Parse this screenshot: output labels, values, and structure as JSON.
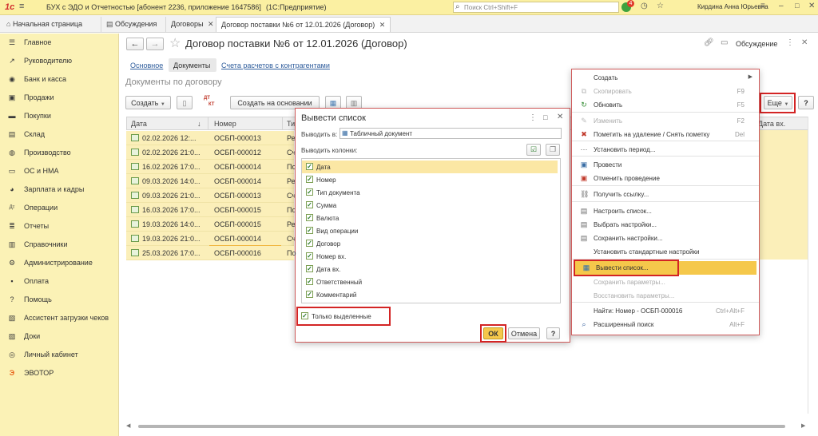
{
  "titlebar": {
    "app_title": "БУХ с ЭДО и Отчетностью [абонент 2236, приложение 1647586]",
    "platform": "(1С:Предприятие)",
    "search_placeholder": "Поиск Ctrl+Shift+F",
    "notification_count": "4",
    "user": "Кирдина Анна Юрьевна"
  },
  "tabs": [
    {
      "label": "Начальная страница"
    },
    {
      "label": "Обсуждения"
    },
    {
      "label": "Договоры"
    },
    {
      "label": "Договор поставки №6 от 12.01.2026 (Договор)"
    }
  ],
  "sidebar": {
    "items": [
      {
        "label": "Главное",
        "icon": "menu-icon"
      },
      {
        "label": "Руководителю",
        "icon": "chart-icon"
      },
      {
        "label": "Банк и касса",
        "icon": "bank-icon"
      },
      {
        "label": "Продажи",
        "icon": "bag-icon"
      },
      {
        "label": "Покупки",
        "icon": "cart-icon"
      },
      {
        "label": "Склад",
        "icon": "warehouse-icon"
      },
      {
        "label": "Производство",
        "icon": "factory-icon"
      },
      {
        "label": "ОС и НМА",
        "icon": "truck-icon"
      },
      {
        "label": "Зарплата и кадры",
        "icon": "people-icon"
      },
      {
        "label": "Операции",
        "icon": "operations-icon"
      },
      {
        "label": "Отчеты",
        "icon": "reports-icon"
      },
      {
        "label": "Справочники",
        "icon": "books-icon"
      },
      {
        "label": "Администрирование",
        "icon": "gear-icon"
      },
      {
        "label": "Оплата",
        "icon": "payment-icon"
      },
      {
        "label": "Помощь",
        "icon": "help-icon"
      },
      {
        "label": "Ассистент загрузки чеков",
        "icon": "receipt-icon"
      },
      {
        "label": "Доки",
        "icon": "docs-icon"
      },
      {
        "label": "Личный кабинет",
        "icon": "user-icon"
      },
      {
        "label": "ЭВОТОР",
        "icon": "evotor-icon"
      }
    ]
  },
  "form": {
    "title": "Договор поставки №6 от 12.01.2026 (Договор)",
    "discussion_label": "Обсуждение",
    "subnav": [
      "Основное",
      "Документы",
      "Счета расчетов с контрагентами"
    ],
    "section_title": "Документы по договору",
    "create_label": "Создать",
    "create_based_label": "Создать на основании",
    "more_label": "Еще",
    "help_label": "?"
  },
  "grid": {
    "columns": [
      "Дата",
      "Номер",
      "Ти",
      "Дата вх."
    ],
    "rows": [
      {
        "date": "02.02.2026 12:00:00",
        "date_shown": "02.02.2026 12:...",
        "number": "ОСБП-000013",
        "type": "Ре"
      },
      {
        "date_shown": "02.02.2026 21:0...",
        "number": "ОСБП-000012",
        "type": "Сч"
      },
      {
        "date_shown": "16.02.2026 17:0...",
        "number": "ОСБП-000014",
        "type": "По"
      },
      {
        "date_shown": "09.03.2026 14:0...",
        "number": "ОСБП-000014",
        "type": "Ре"
      },
      {
        "date_shown": "09.03.2026 21:0...",
        "number": "ОСБП-000013",
        "type": "Сч"
      },
      {
        "date_shown": "16.03.2026 17:0...",
        "number": "ОСБП-000015",
        "type": "По"
      },
      {
        "date_shown": "19.03.2026 14:0...",
        "number": "ОСБП-000015",
        "type": "Ре"
      },
      {
        "date_shown": "19.03.2026 21:0...",
        "number": "ОСБП-000014",
        "type": "Сч"
      },
      {
        "date_shown": "25.03.2026 17:0...",
        "number": "ОСБП-000016",
        "type": "По"
      }
    ]
  },
  "dialog": {
    "title": "Вывести список",
    "output_to_label": "Выводить в:",
    "output_to_value": "Табличный документ",
    "columns_label": "Выводить колонки:",
    "columns": [
      "Дата",
      "Номер",
      "Тип документа",
      "Сумма",
      "Валюта",
      "Вид операции",
      "Договор",
      "Номер вх.",
      "Дата вх.",
      "Ответственный",
      "Комментарий"
    ],
    "only_selected_label": "Только выделенные",
    "ok_label": "ОК",
    "cancel_label": "Отмена",
    "help_label": "?"
  },
  "menu": {
    "items": [
      {
        "label": "Создать",
        "shortcut": "",
        "icon": "",
        "disabled": false,
        "submenu": true
      },
      {
        "label": "Скопировать",
        "shortcut": "F9",
        "icon": "copy-icon",
        "disabled": true
      },
      {
        "label": "Обновить",
        "shortcut": "F5",
        "icon": "refresh-icon",
        "disabled": false
      },
      {
        "label": "Изменить",
        "shortcut": "F2",
        "icon": "edit-icon",
        "disabled": true
      },
      {
        "label": "Пометить на удаление / Снять пометку",
        "shortcut": "Del",
        "icon": "delete-mark-icon",
        "disabled": false
      },
      {
        "label": "Установить период...",
        "shortcut": "",
        "icon": "period-icon",
        "disabled": false
      },
      {
        "label": "Провести",
        "shortcut": "",
        "icon": "post-icon",
        "disabled": false
      },
      {
        "label": "Отменить проведение",
        "shortcut": "",
        "icon": "unpost-icon",
        "disabled": false
      },
      {
        "label": "Получить ссылку...",
        "shortcut": "",
        "icon": "link-icon",
        "disabled": false
      },
      {
        "label": "Настроить список...",
        "shortcut": "",
        "icon": "list-settings-icon",
        "disabled": false
      },
      {
        "label": "Выбрать настройки...",
        "shortcut": "",
        "icon": "choose-settings-icon",
        "disabled": false
      },
      {
        "label": "Сохранить настройки...",
        "shortcut": "",
        "icon": "save-settings-icon",
        "disabled": false
      },
      {
        "label": "Установить стандартные настройки",
        "shortcut": "",
        "icon": "",
        "disabled": false
      },
      {
        "label": "Вывести список...",
        "shortcut": "",
        "icon": "output-list-icon",
        "disabled": false
      },
      {
        "label": "Сохранить параметры...",
        "shortcut": "",
        "icon": "",
        "disabled": true
      },
      {
        "label": "Восстановить параметры...",
        "shortcut": "",
        "icon": "",
        "disabled": true
      },
      {
        "label": "Найти: Номер - ОСБП-000016",
        "shortcut": "Ctrl+Alt+F",
        "icon": "",
        "disabled": false
      },
      {
        "label": "Расширенный поиск",
        "shortcut": "Alt+F",
        "icon": "search-icon",
        "disabled": false
      }
    ]
  },
  "colors": {
    "sidebar_bg": "#fbf2b6",
    "titlebar_bg": "#fbf0a2",
    "row_bg": "#fbefb9",
    "highlight": "#f5c84b",
    "annotation_red": "#d32424"
  }
}
